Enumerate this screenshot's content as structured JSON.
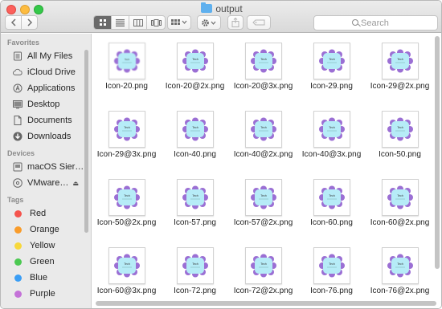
{
  "window": {
    "title": "output"
  },
  "toolbar": {
    "back_icon": "chevron-left-icon",
    "forward_icon": "chevron-right-icon",
    "view_modes": [
      "icon-view",
      "list-view",
      "column-view",
      "cover-flow-view"
    ],
    "active_view": "icon-view",
    "search_placeholder": "Search"
  },
  "sidebar": {
    "favorites_header": "Favorites",
    "favorites": [
      {
        "label": "All My Files",
        "icon": "all-my-files-icon"
      },
      {
        "label": "iCloud Drive",
        "icon": "cloud-icon"
      },
      {
        "label": "Applications",
        "icon": "applications-icon"
      },
      {
        "label": "Desktop",
        "icon": "desktop-icon"
      },
      {
        "label": "Documents",
        "icon": "documents-icon"
      },
      {
        "label": "Downloads",
        "icon": "downloads-icon"
      }
    ],
    "devices_header": "Devices",
    "devices": [
      {
        "label": "macOS Sier…",
        "icon": "hard-drive-icon"
      },
      {
        "label": "VMware…",
        "icon": "disc-icon",
        "eject": "⏏"
      }
    ],
    "tags_header": "Tags",
    "tags": [
      {
        "label": "Red",
        "color": "#f4544d"
      },
      {
        "label": "Orange",
        "color": "#f99c2b"
      },
      {
        "label": "Yellow",
        "color": "#f7d83b"
      },
      {
        "label": "Green",
        "color": "#4cc952"
      },
      {
        "label": "Blue",
        "color": "#3b9ef5"
      },
      {
        "label": "Purple",
        "color": "#c472d8"
      }
    ]
  },
  "files": [
    "Icon-20.png",
    "Icon-20@2x.png",
    "Icon-20@3x.png",
    "Icon-29.png",
    "Icon-29@2x.png",
    "Icon-29@3x.png",
    "Icon-40.png",
    "Icon-40@2x.png",
    "Icon-40@3x.png",
    "Icon-50.png",
    "Icon-50@2x.png",
    "Icon-57.png",
    "Icon-57@2x.png",
    "Icon-60.png",
    "Icon-60@2x.png",
    "Icon-60@3x.png",
    "Icon-72.png",
    "Icon-72@2x.png",
    "Icon-76.png",
    "Icon-76@2x.png"
  ],
  "thumbnail_text": "Tech",
  "colors": {
    "thumb_purple": "#9b6fd4",
    "thumb_cyan": "#b6ecf7",
    "accent": "#5fb0ee"
  }
}
